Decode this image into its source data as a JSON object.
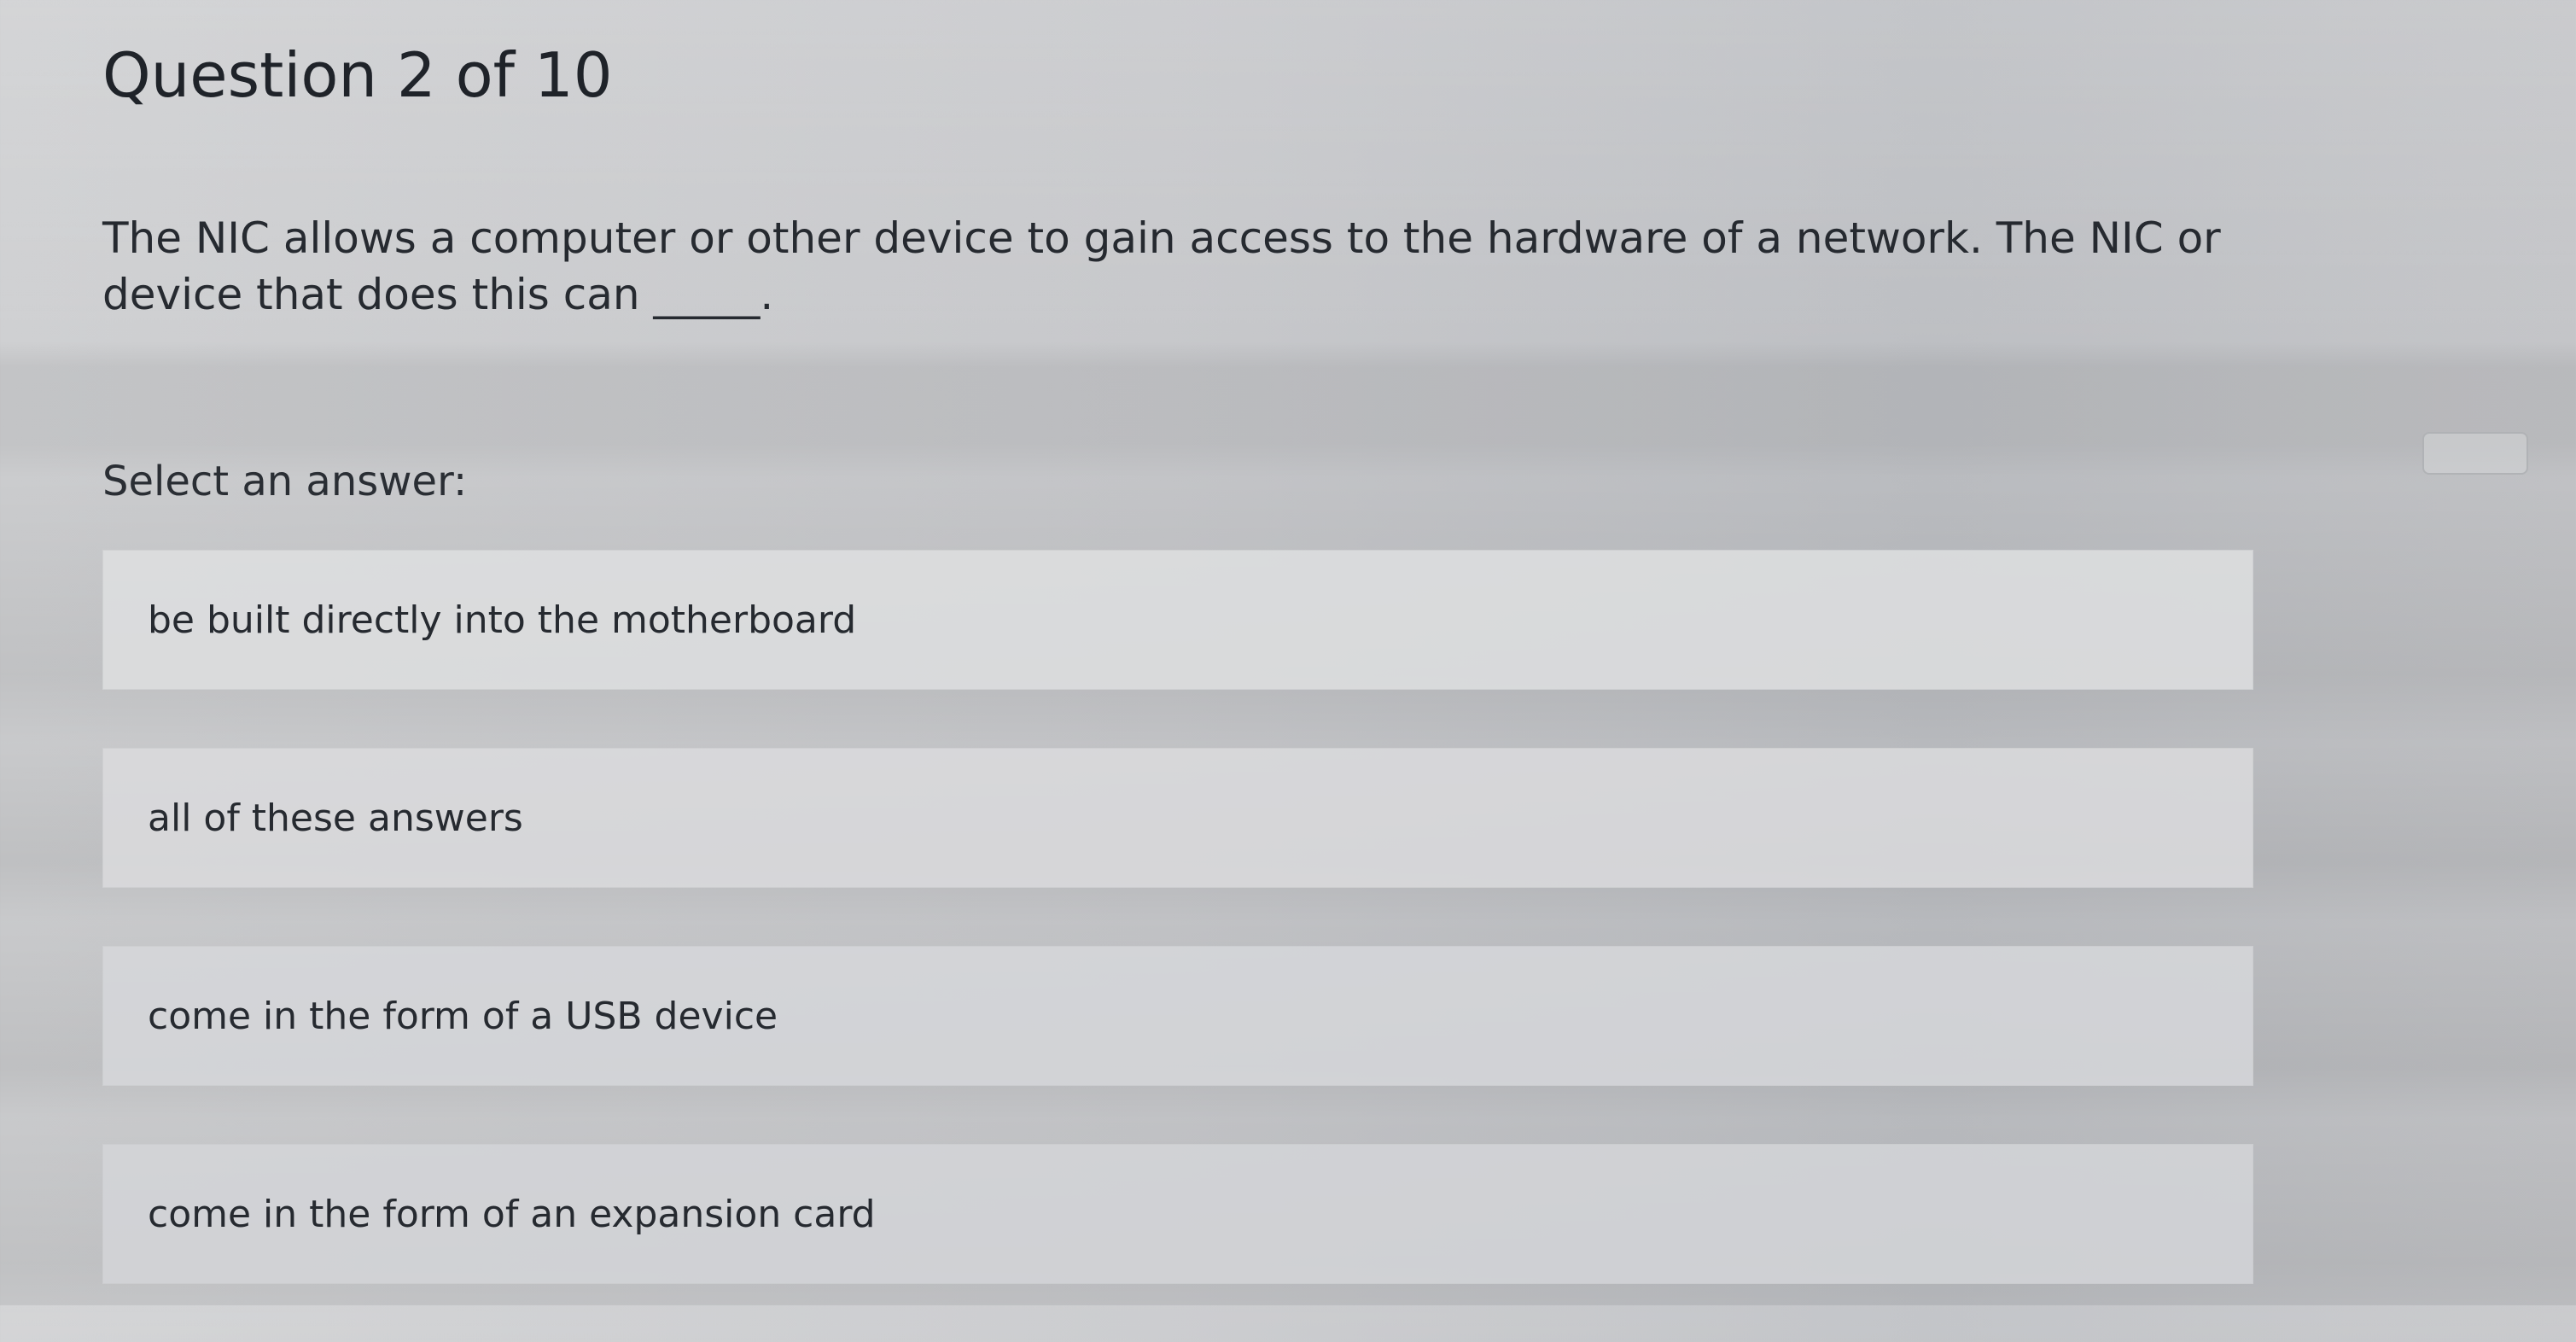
{
  "quiz": {
    "header": "Question 2 of 10",
    "question_text": "The NIC allows a computer or other device to gain access to the hardware of a network. The NIC or device that does this can _____.",
    "select_prompt": "Select an answer:",
    "answers": [
      "be built directly into the motherboard",
      "all of these answers",
      "come in the form of a USB device",
      "come in the form of an expansion card"
    ]
  }
}
